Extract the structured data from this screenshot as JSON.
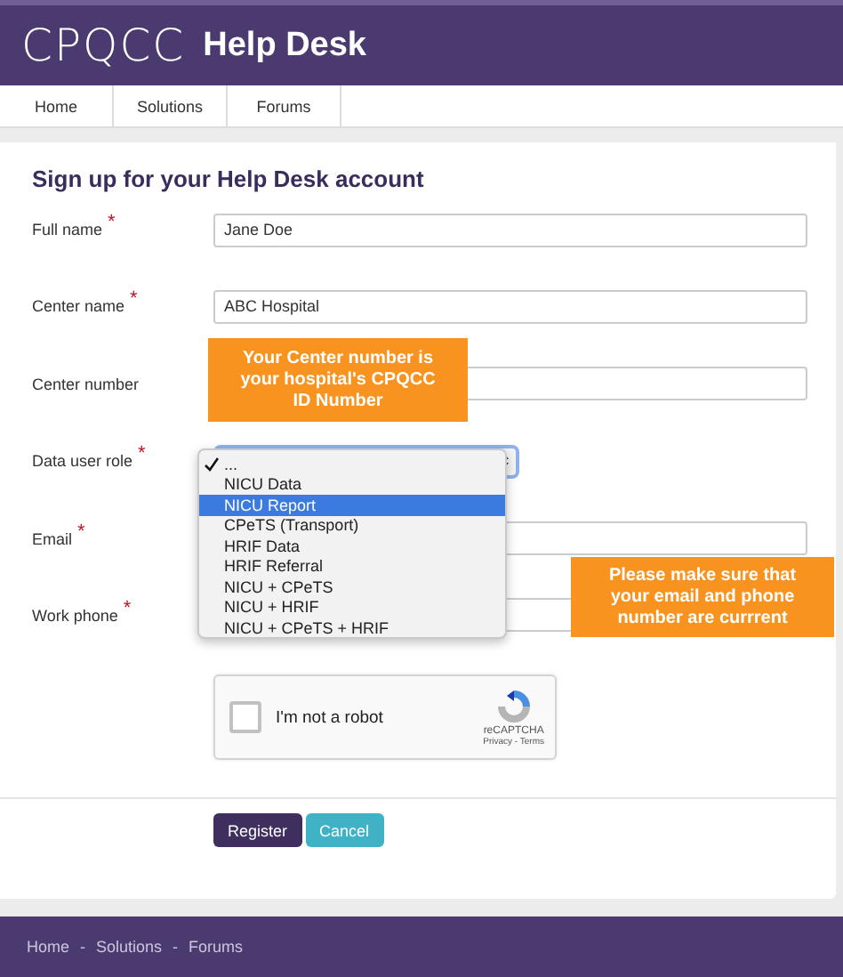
{
  "header": {
    "logo": "CPQCC",
    "title": "Help Desk"
  },
  "nav": [
    {
      "label": "Home"
    },
    {
      "label": "Solutions"
    },
    {
      "label": "Forums"
    }
  ],
  "form": {
    "heading": "Sign up for your Help Desk account",
    "fields": [
      {
        "kind": "text",
        "label": "Full name",
        "required_mark": "*",
        "value": "Jane Doe"
      },
      {
        "kind": "text",
        "label": "Center name",
        "required_mark": "*",
        "value": "ABC Hospital"
      },
      {
        "kind": "text",
        "label": "Center number"
      },
      {
        "kind": "select",
        "label": "Data user role",
        "required_mark": "*"
      },
      {
        "kind": "text",
        "label": "Email",
        "required_mark": "*"
      },
      {
        "kind": "text",
        "label": "Work phone",
        "required_mark": "*"
      }
    ],
    "dropdown": [
      {
        "label": "...",
        "selected": true,
        "highlighted": false
      },
      {
        "label": "NICU Data",
        "selected": false,
        "highlighted": false
      },
      {
        "label": "NICU Report",
        "selected": false,
        "highlighted": true
      },
      {
        "label": "CPeTS (Transport)",
        "selected": false,
        "highlighted": false
      },
      {
        "label": "HRIF Data",
        "selected": false,
        "highlighted": false
      },
      {
        "label": "HRIF Referral",
        "selected": false,
        "highlighted": false
      },
      {
        "label": "NICU + CPeTS",
        "selected": false,
        "highlighted": false
      },
      {
        "label": "NICU + HRIF",
        "selected": false,
        "highlighted": false
      },
      {
        "label": "NICU + CPeTS + HRIF",
        "selected": false,
        "highlighted": false
      }
    ],
    "captcha": {
      "label": "I'm not a robot",
      "checked": false,
      "brand": "reCAPTCHA",
      "links": "Privacy - Terms"
    },
    "buttons": [
      {
        "kind": "primary",
        "label": "Register"
      },
      {
        "kind": "secondary",
        "label": "Cancel"
      }
    ]
  },
  "callouts": [
    "Your Center number is your hospital's CPQCC ID Number",
    "Please make sure that your email and phone number are currrent"
  ],
  "footer": {
    "links": [
      "Home",
      "Solutions",
      "Forums"
    ],
    "separator": "-"
  }
}
